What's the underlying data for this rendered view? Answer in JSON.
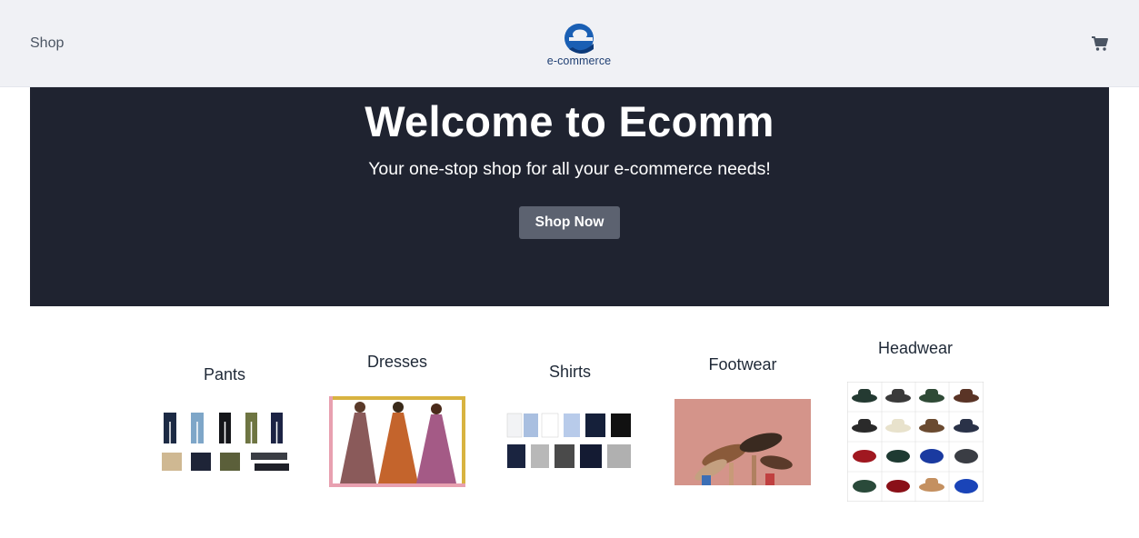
{
  "nav": {
    "shop_label": "Shop",
    "logo_text": "e-commerce",
    "cart_icon": "shopping-cart-icon"
  },
  "hero": {
    "title": "Welcome to Ecomm",
    "subtitle": "Your one-stop shop for all your e-commerce needs!",
    "button_label": "Shop Now"
  },
  "categories": [
    {
      "name": "Pants"
    },
    {
      "name": "Dresses"
    },
    {
      "name": "Shirts"
    },
    {
      "name": "Footwear"
    },
    {
      "name": "Headwear"
    }
  ],
  "colors": {
    "navbar_bg": "#f0f1f5",
    "hero_bg": "#1f2330",
    "button_bg": "#5c6270",
    "logo_blue": "#1a5fb4"
  }
}
